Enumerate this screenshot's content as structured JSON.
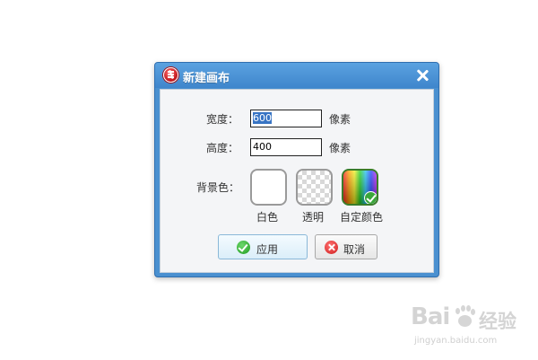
{
  "dialog": {
    "title": "新建画布",
    "close_icon": "close-icon",
    "width_label": "宽度：",
    "width_value": "600",
    "width_unit": "像素",
    "height_label": "高度：",
    "height_value": "400",
    "height_unit": "像素",
    "background_label": "背景色：",
    "background_options": [
      {
        "label": "白色",
        "swatch": "white"
      },
      {
        "label": "透明",
        "swatch": "checkerboard"
      },
      {
        "label": "自定颜色",
        "swatch": "rainbow-gradient",
        "selected": true
      }
    ],
    "apply_label": "应用",
    "cancel_label": "取消"
  },
  "watermark": {
    "logo_text": "Bai",
    "site_text": "经验",
    "url": "jingyan.baidu.com"
  },
  "colors": {
    "titlebar": "#4a90d0",
    "content_bg": "#f4f5f7",
    "selected_border": "#3a7d2a",
    "apply_icon": "#1f9a1f",
    "cancel_icon": "#cf1d1d"
  }
}
